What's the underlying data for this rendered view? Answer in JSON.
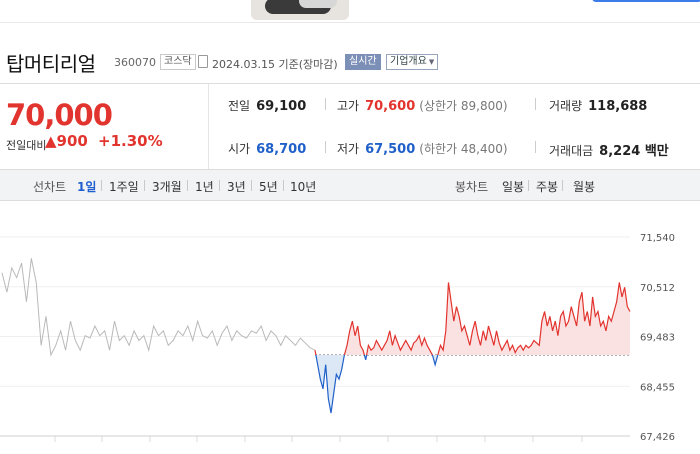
{
  "stock": {
    "name": "탑머티리얼",
    "code": "360070",
    "market": "코스닥",
    "as_of": "2024.03.15 기준(장마감)",
    "realtime_label": "실시간",
    "company_info_label": "기업개요"
  },
  "quote": {
    "price": "70,000",
    "change_label": "전일대비",
    "change": "▲900",
    "change_pct": "+1.30%",
    "prev_close_label": "전일",
    "prev_close": "69,100",
    "high_label": "고가",
    "high": "70,600",
    "upper_limit": "(상한가 89,800)",
    "volume_label": "거래량",
    "volume": "118,688",
    "open_label": "시가",
    "open": "68,700",
    "low_label": "저가",
    "low": "67,500",
    "lower_limit": "(하한가 48,400)",
    "trade_value_label": "거래대금",
    "trade_value": "8,224 백만"
  },
  "chart_tabs": {
    "line_label": "선차트",
    "line_periods": [
      "1일",
      "1주일",
      "3개월",
      "1년",
      "3년",
      "5년",
      "10년"
    ],
    "active": "1일",
    "candle_label": "봉차트",
    "candle_periods": [
      "일봉",
      "주봉",
      "월봉"
    ]
  },
  "colors": {
    "up": "#e2342e",
    "down": "#1f60c9",
    "accent": "#1f5ecf"
  },
  "chart_data": {
    "type": "line",
    "reference_price": 69100,
    "ylim": [
      67426,
      71540
    ],
    "yticks": [
      "71,540",
      "70,512",
      "69,483",
      "68,455",
      "67,426"
    ],
    "pre_market_values": [
      70800,
      70400,
      70900,
      70700,
      71000,
      70200,
      71100,
      70600,
      69300,
      69900,
      69100,
      69300,
      69600,
      69200,
      69800,
      69400,
      69200,
      69500,
      69450,
      69700,
      69500,
      69600,
      69200,
      69800,
      69400,
      69500,
      69300,
      69600,
      69400,
      69500,
      69200,
      69700,
      69500,
      69600,
      69300,
      69400,
      69600,
      69500,
      69700,
      69400,
      69800,
      69500,
      69450,
      69600,
      69300,
      69550,
      69700,
      69400,
      69600,
      69500,
      69450,
      69600,
      69550,
      69700,
      69400,
      69600,
      69500,
      69300,
      69500,
      69400,
      69300,
      69450,
      69350,
      69250,
      69200
    ],
    "session_values": [
      69200,
      68900,
      68600,
      68400,
      68900,
      68200,
      67900,
      68300,
      68700,
      68600,
      68800,
      69100,
      69300,
      69600,
      69800,
      69500,
      69700,
      69300,
      69200,
      69000,
      69300,
      69200,
      69250,
      69400,
      69300,
      69200,
      69300,
      69400,
      69600,
      69300,
      69500,
      69350,
      69200,
      69300,
      69400,
      69300,
      69200,
      69350,
      69400,
      69500,
      69300,
      69450,
      69300,
      69200,
      69100,
      68900,
      69100,
      69300,
      69200,
      69600,
      70600,
      70200,
      69800,
      70100,
      69900,
      69600,
      69700,
      69500,
      69300,
      69600,
      69800,
      69500,
      69300,
      69600,
      69400,
      69700,
      69500,
      69300,
      69600,
      69350,
      69200,
      69300,
      69400,
      69200,
      69300,
      69150,
      69250,
      69300,
      69200,
      69300,
      69250,
      69300,
      69400,
      69350,
      69300,
      69800,
      70000,
      69700,
      69900,
      69600,
      69800,
      69500,
      69900,
      70000,
      69700,
      69800,
      70100,
      69900,
      69700,
      70200,
      70400,
      69800,
      70000,
      69700,
      70300,
      69900,
      70000,
      69700,
      69800,
      69600,
      69900,
      69800,
      70000,
      70200,
      70600,
      70300,
      70500,
      70100,
      70000
    ]
  }
}
